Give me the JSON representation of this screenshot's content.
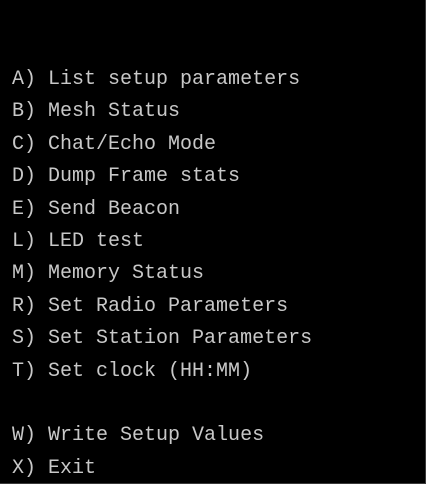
{
  "terminal": {
    "background": "#000000",
    "text_color": "#c8c8c8",
    "menu_group_1": [
      {
        "key": "A)",
        "label": "List setup parameters"
      },
      {
        "key": "B)",
        "label": "Mesh Status"
      },
      {
        "key": "C)",
        "label": "Chat/Echo Mode"
      },
      {
        "key": "D)",
        "label": "Dump Frame stats"
      },
      {
        "key": "E)",
        "label": "Send Beacon"
      },
      {
        "key": "L)",
        "label": "LED test"
      },
      {
        "key": "M)",
        "label": "Memory Status"
      },
      {
        "key": "R)",
        "label": "Set Radio Parameters"
      },
      {
        "key": "S)",
        "label": "Set Station Parameters"
      },
      {
        "key": "T)",
        "label": "Set clock (HH:MM)"
      }
    ],
    "menu_group_2": [
      {
        "key": "W)",
        "label": "Write Setup Values"
      },
      {
        "key": "X)",
        "label": "Exit"
      }
    ]
  }
}
